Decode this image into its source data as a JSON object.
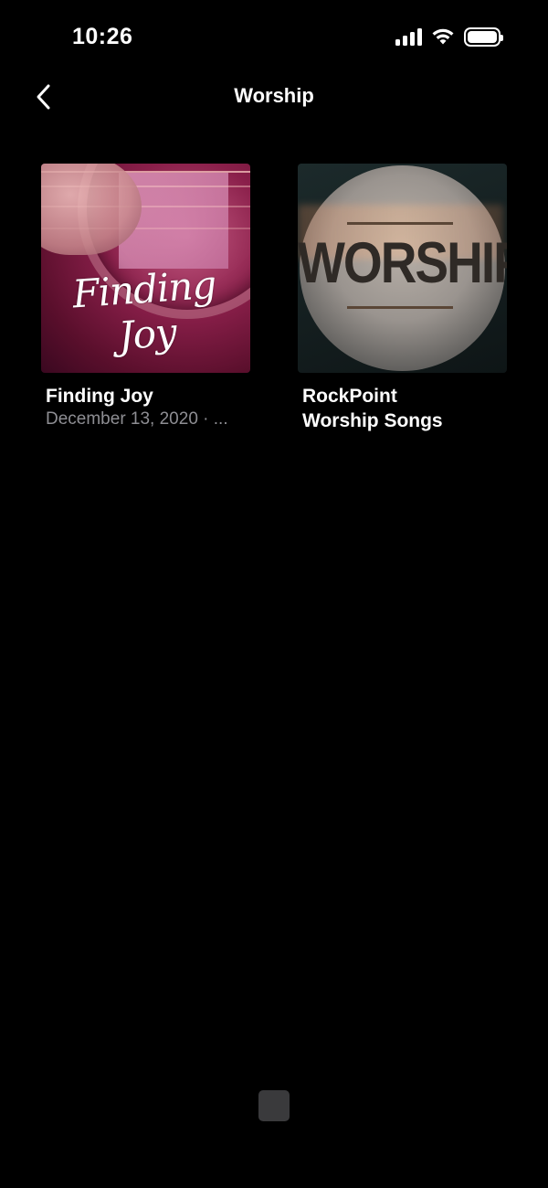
{
  "status_bar": {
    "time": "10:26",
    "icons": [
      "cellular-signal-icon",
      "wifi-icon",
      "battery-icon"
    ]
  },
  "nav": {
    "back_icon": "chevron-left-icon",
    "title": "Worship"
  },
  "items": [
    {
      "title": "Finding Joy",
      "subtitle": "December 13, 2020 · ...",
      "thumbnail_text": "Finding Joy"
    },
    {
      "title_line1": "RockPoint",
      "title_line2": "Worship Songs",
      "thumbnail_text": "WORSHIP"
    }
  ],
  "colors": {
    "background": "#000000",
    "text_primary": "#ffffff",
    "text_secondary": "#8e8e93"
  }
}
